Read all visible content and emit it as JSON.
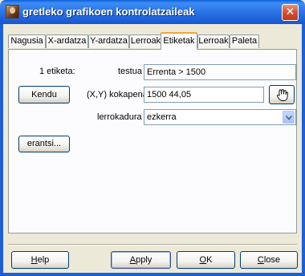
{
  "window": {
    "title": "gretleko grafikoen kontrolatzaileak",
    "close_glyph": "✕"
  },
  "tabs": [
    {
      "label": "Nagusia",
      "active": false
    },
    {
      "label": "X-ardatza",
      "active": false
    },
    {
      "label": "Y-ardatza",
      "active": false
    },
    {
      "label": "Lerroak",
      "active": false
    },
    {
      "label": "Etiketak",
      "active": true
    },
    {
      "label": "Lerroak",
      "active": false
    },
    {
      "label": "Paleta",
      "active": false
    }
  ],
  "label_panel": {
    "label_number": "1 etiketa:",
    "text_label": "testua",
    "text_value": "Errenta > 1500",
    "remove_button": "Kendu",
    "position_label": "(X,Y) kokapena",
    "position_value": "1500 44,05",
    "pick_icon": "pointing-hand-icon",
    "justify_label": "lerrokadura",
    "justify_value": "ezkerra",
    "add_button": "erantsi..."
  },
  "buttons": {
    "help": {
      "prefix": "",
      "underline": "H",
      "rest": "elp"
    },
    "apply": {
      "prefix": "",
      "underline": "A",
      "rest": "pply"
    },
    "ok": {
      "prefix": "",
      "underline": "O",
      "rest": "K"
    },
    "close": {
      "prefix": "",
      "underline": "C",
      "rest": "lose"
    }
  },
  "colors": {
    "titlebar": "#1d5fd6",
    "active_tab_accent": "#f5a433",
    "dialog_background": "#ece9d8"
  }
}
